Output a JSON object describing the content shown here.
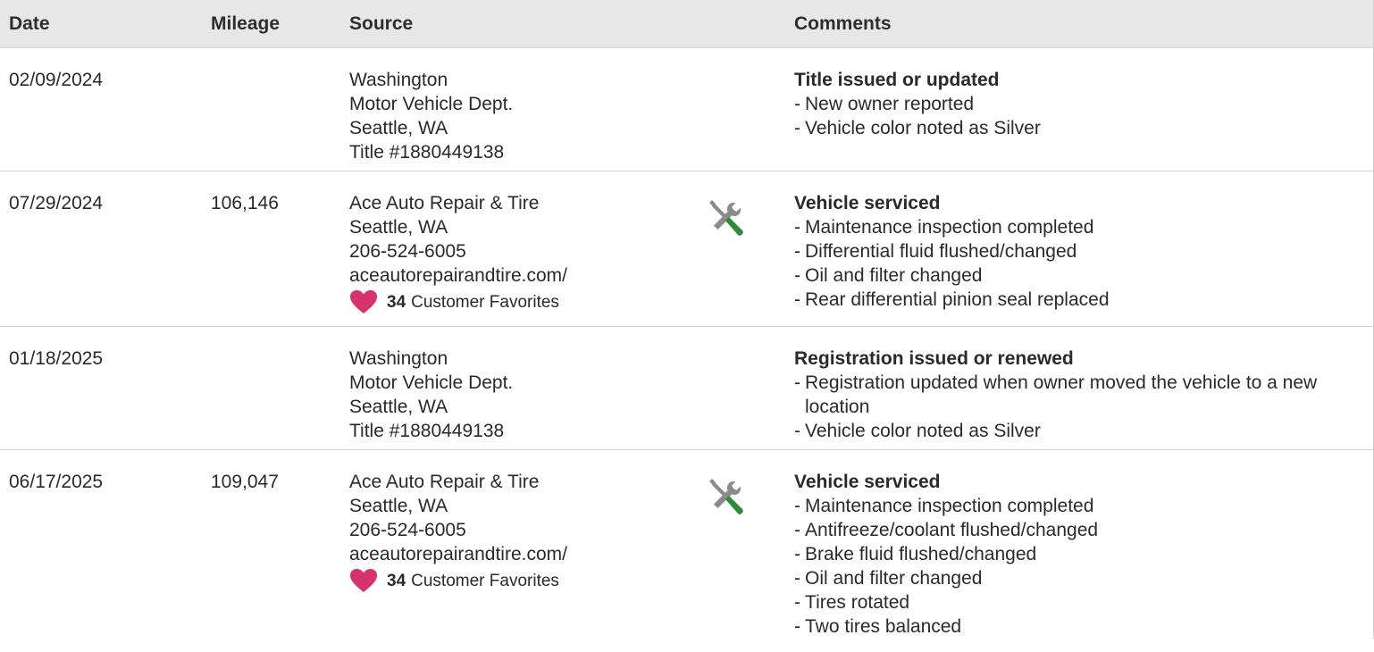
{
  "header": {
    "date": "Date",
    "mileage": "Mileage",
    "source": "Source",
    "comments": "Comments"
  },
  "records": [
    {
      "date": "02/09/2024",
      "mileage": "",
      "source": [
        "Washington",
        "Motor Vehicle Dept.",
        "Seattle, WA",
        "Title #1880449138"
      ],
      "icon": "",
      "comment_title": "Title issued or updated",
      "comments": [
        "New owner reported",
        "Vehicle color noted as Silver"
      ]
    },
    {
      "date": "07/29/2024",
      "mileage": "106,146",
      "source": [
        "Ace Auto Repair & Tire",
        "Seattle, WA",
        "206-524-6005",
        "aceautorepairandtire.com/"
      ],
      "favorites_count": "34",
      "favorites_label": "Customer Favorites",
      "icon": "service-tools-icon",
      "comment_title": "Vehicle serviced",
      "comments": [
        "Maintenance inspection completed",
        "Differential fluid flushed/changed",
        "Oil and filter changed",
        "Rear differential pinion seal replaced"
      ]
    },
    {
      "date": "01/18/2025",
      "mileage": "",
      "source": [
        "Washington",
        "Motor Vehicle Dept.",
        "Seattle, WA",
        "Title #1880449138"
      ],
      "icon": "",
      "comment_title": "Registration issued or renewed",
      "comments": [
        "Registration updated when owner moved the vehicle to a new location",
        "Vehicle color noted as Silver"
      ]
    },
    {
      "date": "06/17/2025",
      "mileage": "109,047",
      "source": [
        "Ace Auto Repair & Tire",
        "Seattle, WA",
        "206-524-6005",
        "aceautorepairandtire.com/"
      ],
      "favorites_count": "34",
      "favorites_label": "Customer Favorites",
      "icon": "service-tools-icon",
      "comment_title": "Vehicle serviced",
      "comments": [
        "Maintenance inspection completed",
        "Antifreeze/coolant flushed/changed",
        "Brake fluid flushed/changed",
        "Oil and filter changed",
        "Tires rotated",
        "Two tires balanced"
      ]
    }
  ],
  "colors": {
    "header_bg": "#e7e7e7",
    "heart": "#d6336c",
    "tool_gray": "#8a8a8a",
    "tool_green": "#2e8b3a"
  }
}
